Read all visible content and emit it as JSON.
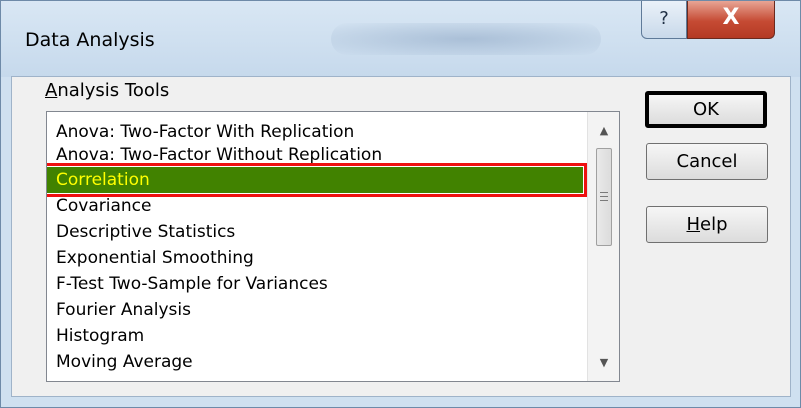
{
  "window": {
    "title": "Data Analysis",
    "help_glyph": "?",
    "close_glyph": "X"
  },
  "group": {
    "label_accel": "A",
    "label_rest": "nalysis Tools"
  },
  "list": {
    "items": [
      {
        "label": "Anova: Two-Factor With Replication",
        "selected": false
      },
      {
        "label": "Anova: Two-Factor Without Replication",
        "selected": false
      },
      {
        "label": "Correlation",
        "selected": true
      },
      {
        "label": "Covariance",
        "selected": false
      },
      {
        "label": "Descriptive Statistics",
        "selected": false
      },
      {
        "label": "Exponential Smoothing",
        "selected": false
      },
      {
        "label": "F-Test Two-Sample for Variances",
        "selected": false
      },
      {
        "label": "Fourier Analysis",
        "selected": false
      },
      {
        "label": "Histogram",
        "selected": false
      },
      {
        "label": "Moving Average",
        "selected": false
      }
    ],
    "selection_color": "#418200",
    "selection_text_color": "#ffff00",
    "highlight_border_color": "#ee1010"
  },
  "scroll": {
    "up_glyph": "▲",
    "down_glyph": "▼"
  },
  "buttons": {
    "ok": "OK",
    "cancel": "Cancel",
    "help_accel": "H",
    "help_rest": "elp"
  },
  "icons": {
    "help": "question-mark-icon",
    "close": "close-icon",
    "scroll_up": "scroll-up-arrow-icon",
    "scroll_down": "scroll-down-arrow-icon"
  }
}
